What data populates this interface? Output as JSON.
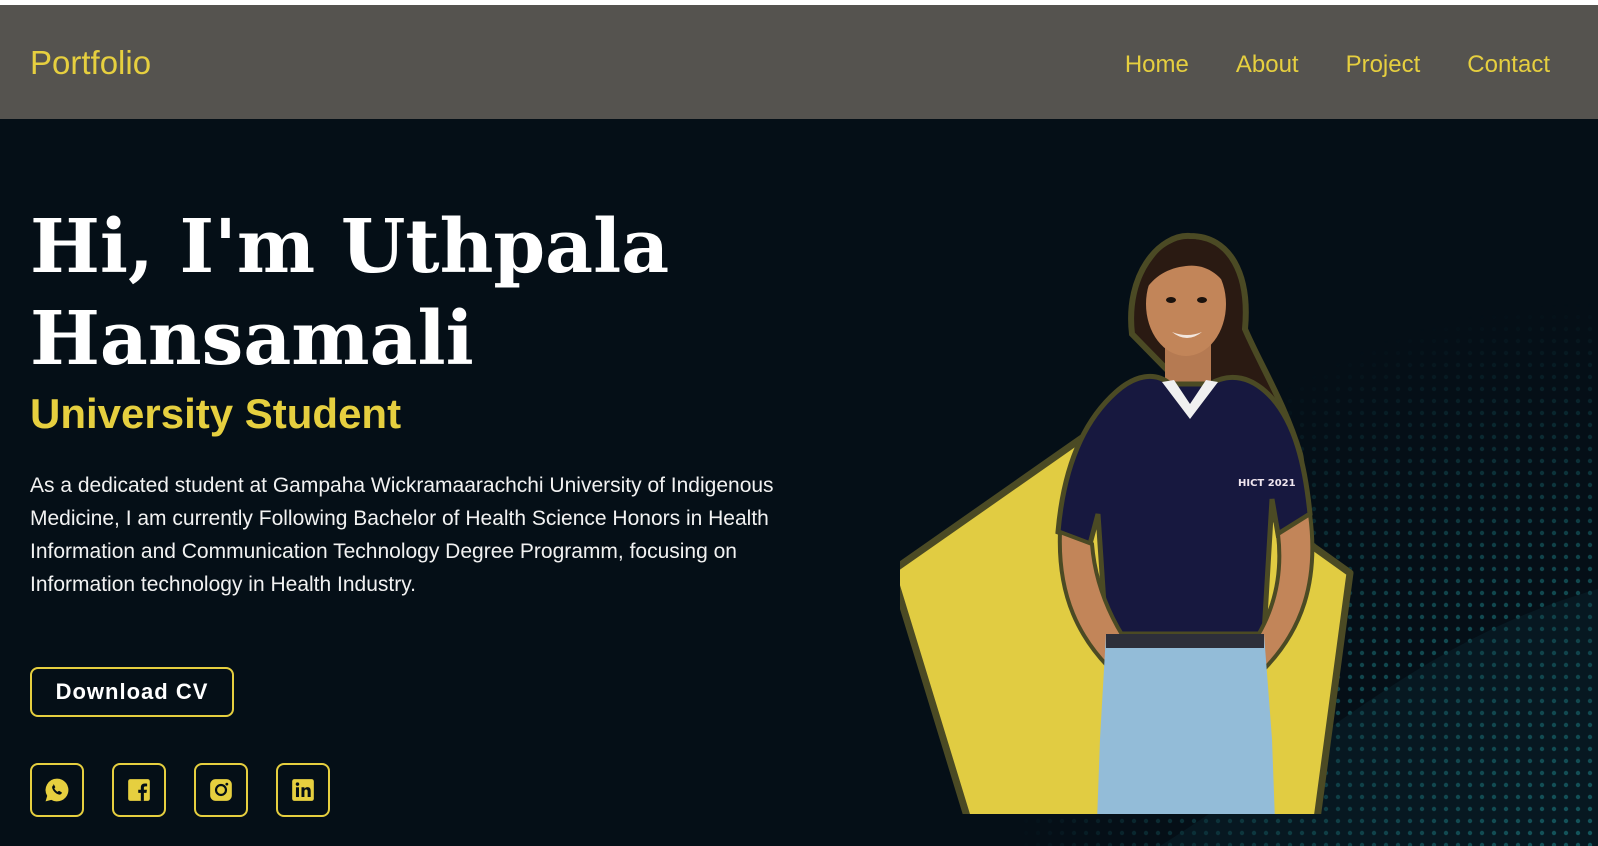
{
  "header": {
    "logo": "Portfolio",
    "nav": [
      {
        "label": "Home"
      },
      {
        "label": "About"
      },
      {
        "label": "Project"
      },
      {
        "label": "Contact"
      }
    ]
  },
  "hero": {
    "greeting_line1": "Hi, I'm Uthpala",
    "greeting_line2": "Hansamali",
    "role": "University Student",
    "bio": "As a dedicated student at Gampaha Wickramaarachchi University of Indigenous Medicine, I am currently Following Bachelor of Health Science Honors in Health Information and Communication Technology Degree Programm, focusing on Information technology in Health Industry.",
    "cv_button": "Download CV",
    "shirt_badge": "HICT 2021",
    "socials": [
      {
        "icon": "whatsapp-icon"
      },
      {
        "icon": "facebook-icon"
      },
      {
        "icon": "instagram-icon"
      },
      {
        "icon": "linkedin-icon"
      }
    ]
  },
  "colors": {
    "accent": "#e6cf3f",
    "header_bg": "#55534f",
    "hero_bg": "#050f17",
    "text": "#ffffff"
  }
}
